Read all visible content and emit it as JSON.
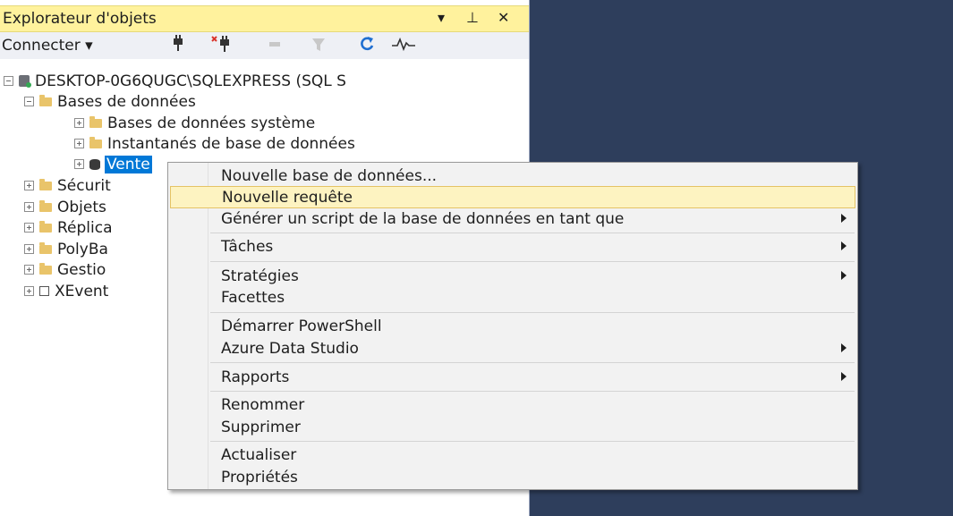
{
  "explorer": {
    "title": "Explorateur d'objets",
    "title_buttons": {
      "dropdown": "▾",
      "pin": "⊥",
      "close": "✕"
    },
    "toolbar": {
      "connect_label": "Connecter ▾",
      "icons": [
        "connect-plug-icon",
        "disconnect-plug-icon",
        "stop-icon",
        "filter-icon",
        "refresh-icon",
        "activity-monitor-icon"
      ]
    },
    "tree": {
      "server": "DESKTOP-0G6QUGC\\SQLEXPRESS (SQL S",
      "databases_folder": "Bases de données",
      "system_databases": "Bases de données système",
      "snapshots": "Instantanés de base de données",
      "selected_db": "Vente",
      "security": "Sécurit",
      "objects": "Objets",
      "replication": "Réplica",
      "polybase": "PolyBa",
      "management": "Gestio",
      "xevent": "XEvent"
    }
  },
  "context_menu": {
    "items": [
      {
        "label": "Nouvelle base de données...",
        "submenu": false
      },
      {
        "label": "Nouvelle requête",
        "submenu": false,
        "highlighted": true
      },
      {
        "label": "Générer un script de la base de données en tant que",
        "submenu": true
      },
      {
        "label": "Tâches",
        "submenu": true
      },
      {
        "label": "Stratégies",
        "submenu": true
      },
      {
        "label": "Facettes",
        "submenu": false
      },
      {
        "label": "Démarrer PowerShell",
        "submenu": false
      },
      {
        "label": "Azure Data Studio",
        "submenu": true
      },
      {
        "label": "Rapports",
        "submenu": true
      },
      {
        "label": "Renommer",
        "submenu": false
      },
      {
        "label": "Supprimer",
        "submenu": false
      },
      {
        "label": "Actualiser",
        "submenu": false
      },
      {
        "label": "Propriétés",
        "submenu": false
      }
    ]
  },
  "colors": {
    "title_bar": "#fff29d",
    "selection": "#0078d7",
    "menu_highlight": "#fdf3c1",
    "dark_background": "#2e3e5c"
  }
}
